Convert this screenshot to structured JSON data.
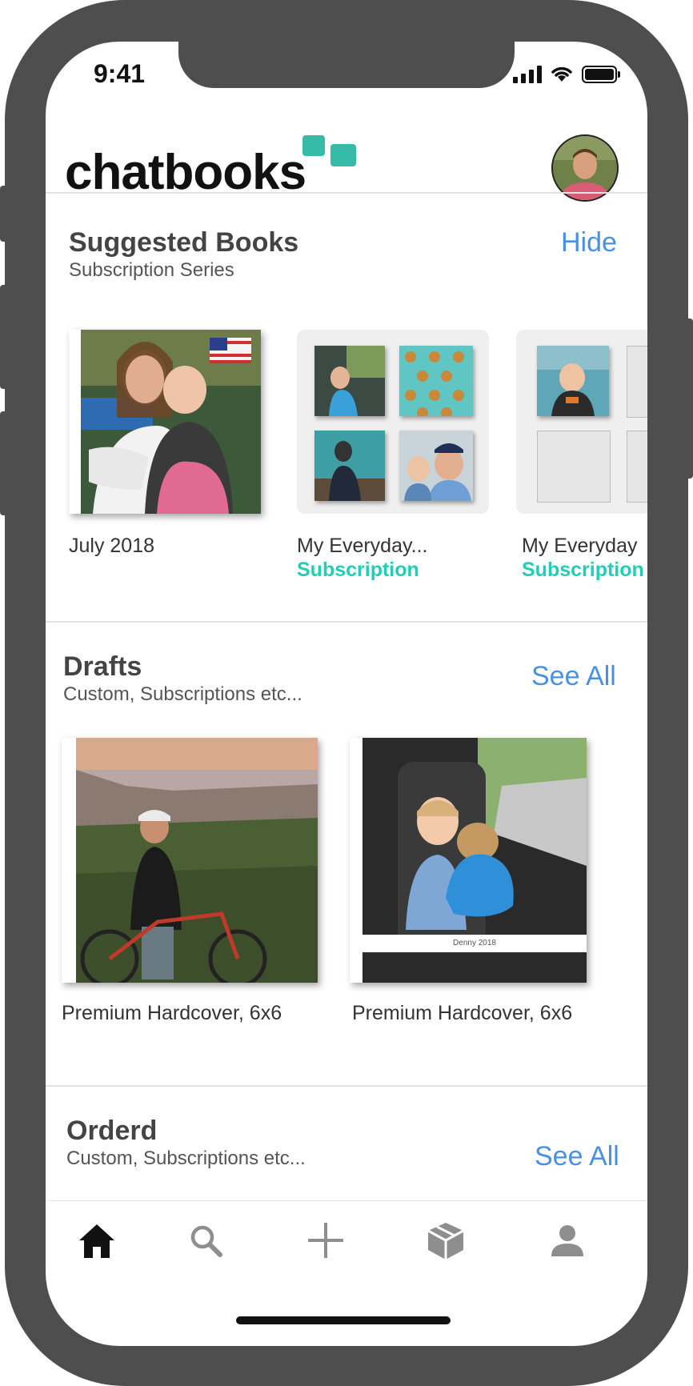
{
  "status_bar": {
    "time": "9:41"
  },
  "header": {
    "logo_text": "chatbooks"
  },
  "suggested": {
    "title": "Suggested Books",
    "subtitle": "Subscription Series",
    "action": "Hide",
    "items": [
      {
        "label": "July 2018",
        "tag": ""
      },
      {
        "label": "My Everyday...",
        "tag": "Subscription"
      },
      {
        "label": "My Everyday",
        "tag": "Subscription"
      }
    ]
  },
  "drafts": {
    "title": "Drafts",
    "subtitle": "Custom, Subscriptions etc...",
    "action": "See All",
    "items": [
      {
        "label": "Premium Hardcover, 6x6"
      },
      {
        "label": "Premium Hardcover, 6x6",
        "cover_caption": "Denny 2018"
      }
    ]
  },
  "ordered": {
    "title": "Orderd",
    "subtitle": "Custom, Subscriptions etc...",
    "action": "See All"
  },
  "tabbar": {
    "tabs": [
      "home-icon",
      "search-icon",
      "add-icon",
      "box-icon",
      "profile-icon"
    ],
    "active_color": "#111111",
    "inactive_color": "#8e8e8e"
  },
  "colors": {
    "accent": "#4a90e2",
    "brand": "#36bba8",
    "subscription": "#23cdb6"
  }
}
